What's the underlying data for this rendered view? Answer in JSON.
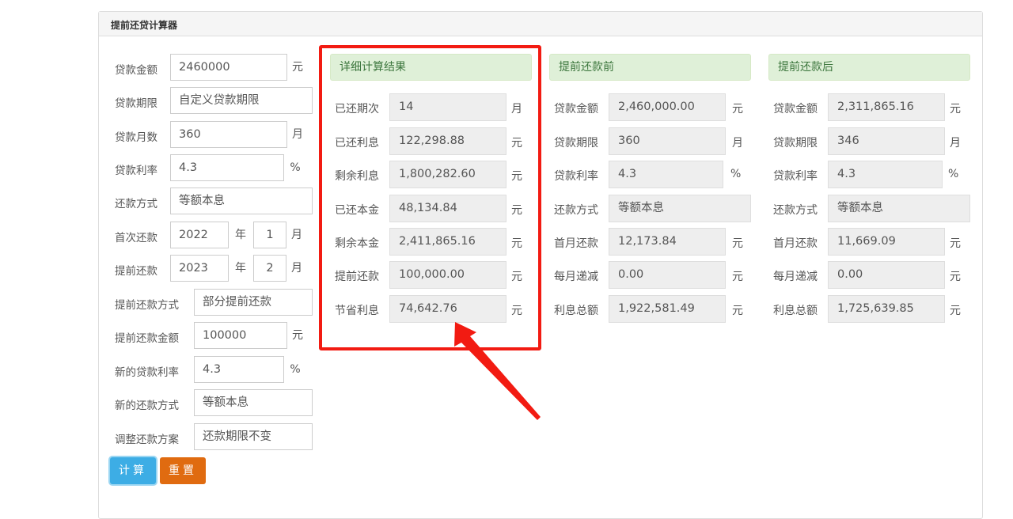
{
  "panel_title": "提前还贷计算器",
  "form": {
    "loan_amount": {
      "label": "贷款金额",
      "value": "2460000",
      "unit": "元"
    },
    "loan_term": {
      "label": "贷款期限",
      "value": "自定义贷款期限"
    },
    "loan_months": {
      "label": "贷款月数",
      "value": "360",
      "unit": "月"
    },
    "loan_rate": {
      "label": "贷款利率",
      "value": "4.3",
      "unit": "%"
    },
    "repay_method": {
      "label": "还款方式",
      "value": "等额本息"
    },
    "first_repay": {
      "label": "首次还款",
      "year": "2022",
      "year_unit": "年",
      "month": "1",
      "month_unit": "月"
    },
    "prepay": {
      "label": "提前还款",
      "year": "2023",
      "year_unit": "年",
      "month": "2",
      "month_unit": "月"
    },
    "prepay_method": {
      "label": "提前还款方式",
      "value": "部分提前还款"
    },
    "prepay_amount": {
      "label": "提前还款金额",
      "value": "100000",
      "unit": "元"
    },
    "new_rate": {
      "label": "新的贷款利率",
      "value": "4.3",
      "unit": "%"
    },
    "new_method": {
      "label": "新的还款方式",
      "value": "等额本息"
    },
    "adjust_plan": {
      "label": "调整还款方案",
      "value": "还款期限不变"
    }
  },
  "buttons": {
    "calc": "计算",
    "reset": "重置"
  },
  "detail": {
    "title": "详细计算结果",
    "rows": [
      {
        "label": "已还期次",
        "value": "14",
        "unit": "月"
      },
      {
        "label": "已还利息",
        "value": "122,298.88",
        "unit": "元"
      },
      {
        "label": "剩余利息",
        "value": "1,800,282.60",
        "unit": "元"
      },
      {
        "label": "已还本金",
        "value": "48,134.84",
        "unit": "元"
      },
      {
        "label": "剩余本金",
        "value": "2,411,865.16",
        "unit": "元"
      },
      {
        "label": "提前还款",
        "value": "100,000.00",
        "unit": "元"
      },
      {
        "label": "节省利息",
        "value": "74,642.76",
        "unit": "元"
      }
    ]
  },
  "before": {
    "title": "提前还款前",
    "rows": [
      {
        "label": "贷款金额",
        "value": "2,460,000.00",
        "unit": "元"
      },
      {
        "label": "贷款期限",
        "value": "360",
        "unit": "月"
      },
      {
        "label": "贷款利率",
        "value": "4.3",
        "unit": "%"
      },
      {
        "label": "还款方式",
        "value": "等额本息",
        "unit": ""
      },
      {
        "label": "首月还款",
        "value": "12,173.84",
        "unit": "元"
      },
      {
        "label": "每月递减",
        "value": "0.00",
        "unit": "元"
      },
      {
        "label": "利息总额",
        "value": "1,922,581.49",
        "unit": "元"
      }
    ]
  },
  "after": {
    "title": "提前还款后",
    "rows": [
      {
        "label": "贷款金额",
        "value": "2,311,865.16",
        "unit": "元"
      },
      {
        "label": "贷款期限",
        "value": "346",
        "unit": "月"
      },
      {
        "label": "贷款利率",
        "value": "4.3",
        "unit": "%"
      },
      {
        "label": "还款方式",
        "value": "等额本息",
        "unit": ""
      },
      {
        "label": "首月还款",
        "value": "11,669.09",
        "unit": "元"
      },
      {
        "label": "每月递减",
        "value": "0.00",
        "unit": "元"
      },
      {
        "label": "利息总额",
        "value": "1,725,639.85",
        "unit": "元"
      }
    ]
  },
  "colors": {
    "highlight": "#f21b12",
    "calc_button": "#3dade5",
    "reset_button": "#e06b10",
    "result_header": "#dff0d8"
  }
}
